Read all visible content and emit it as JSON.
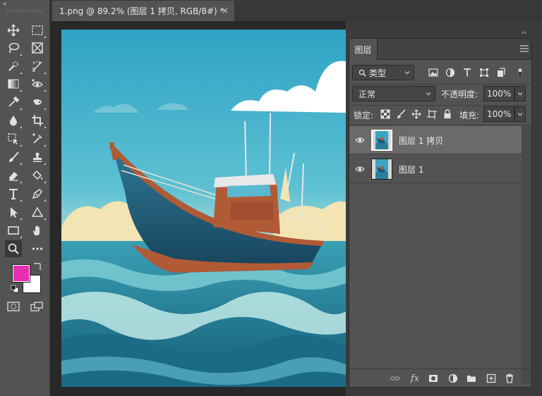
{
  "document": {
    "tab_title": "1.png @ 89.2% (图层 1 拷贝, RGB/8#) *",
    "close_glyph": "×"
  },
  "toolbar": {
    "collapse_glyph": "«",
    "tools_left": [
      "move-icon",
      "lasso-icon",
      "quick-selection-icon",
      "gradient-icon",
      "eyedropper-icon",
      "blur-drop-icon",
      "object-selection-icon",
      "brush-icon",
      "eraser-icon",
      "type-icon",
      "path-selection-icon",
      "rectangle-icon",
      "zoom-icon"
    ],
    "tools_right": [
      "marquee-icon",
      "frame-icon",
      "ruler-icon",
      "red-eye-icon",
      "smudge-icon",
      "crop-icon",
      "color-sampler-icon",
      "stamp-icon",
      "paint-bucket-icon",
      "pen-icon",
      "triangle-icon",
      "hand-icon",
      "more-tools-icon"
    ],
    "active_tool": "zoom-icon",
    "foreground_color": "#e62fb1",
    "background_color": "#ffffff"
  },
  "layers_panel": {
    "tab_label": "图层",
    "collapse_glyph": "‹‹",
    "close_glyph": "×",
    "filter_kind": "类型",
    "blend_mode": "正常",
    "opacity_label": "不透明度:",
    "opacity_value": "100%",
    "lock_label": "锁定:",
    "fill_label": "填充:",
    "fill_value": "100%",
    "layers": [
      {
        "name": "图层 1 拷贝",
        "visible": true,
        "selected": true
      },
      {
        "name": "图层 1",
        "visible": true,
        "selected": false
      }
    ],
    "footer_icons": [
      "link-icon",
      "fx-icon",
      "mask-icon",
      "adjustment-icon",
      "folder-icon",
      "new-layer-icon",
      "trash-icon"
    ],
    "fx_label": "fx"
  },
  "colors": {
    "panel_bg": "#535353",
    "selected_layer": "#6a6a6a",
    "workspace": "#282828"
  }
}
